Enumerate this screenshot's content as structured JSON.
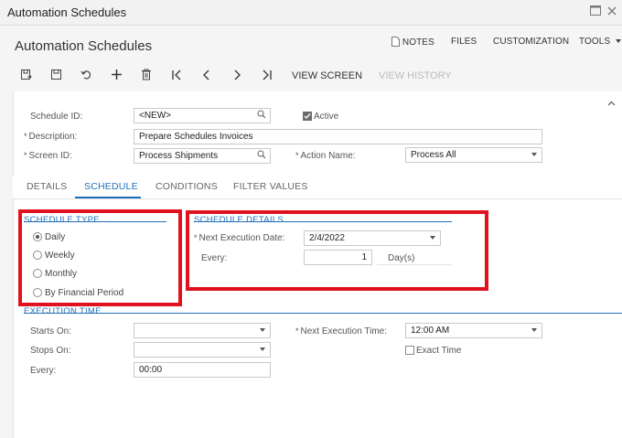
{
  "window": {
    "title": "Automation Schedules",
    "maximize_icon": "maximize-icon",
    "close_icon": "close-icon"
  },
  "page": {
    "title": "Automation Schedules",
    "links": {
      "notes": "NOTES",
      "files": "FILES",
      "customization": "CUSTOMIZATION",
      "tools": "TOOLS"
    }
  },
  "toolbar": {
    "view_screen": "VIEW SCREEN",
    "view_history": "VIEW HISTORY"
  },
  "form": {
    "schedule_id_label": "Schedule ID:",
    "schedule_id_value": "<NEW>",
    "active_label": "Active",
    "active_checked": true,
    "description_label": "Description:",
    "description_value": "Prepare Schedules Invoices",
    "screen_id_label": "Screen ID:",
    "screen_id_value": "Process Shipments",
    "action_name_label": "Action Name:",
    "action_name_value": "Process All"
  },
  "tabs": {
    "details": "DETAILS",
    "schedule": "SCHEDULE",
    "conditions": "CONDITIONS",
    "filter_values": "FILTER VALUES",
    "active": "schedule"
  },
  "schedule_type": {
    "title": "SCHEDULE TYPE",
    "options": [
      "Daily",
      "Weekly",
      "Monthly",
      "By Financial Period"
    ],
    "selected": "Daily"
  },
  "schedule_details": {
    "title": "SCHEDULE DETAILS",
    "next_execution_date_label": "Next Execution Date:",
    "next_execution_date_value": "2/4/2022",
    "every_label": "Every:",
    "every_value": "1",
    "every_unit": "Day(s)"
  },
  "execution_time": {
    "title": "EXECUTION TIME",
    "starts_on_label": "Starts On:",
    "starts_on_value": "",
    "stops_on_label": "Stops On:",
    "stops_on_value": "",
    "every_label": "Every:",
    "every_value": "00:00",
    "next_execution_time_label": "Next Execution Time:",
    "next_execution_time_value": "12:00 AM",
    "exact_time_label": "Exact Time",
    "exact_time_checked": false
  },
  "colors": {
    "accent": "#1f6fb8",
    "highlight": "#e0121e"
  }
}
